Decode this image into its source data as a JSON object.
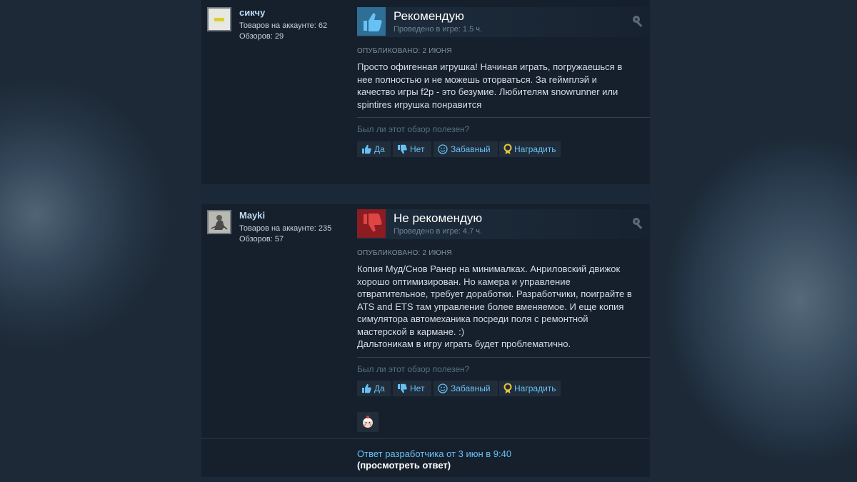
{
  "reviews": [
    {
      "author": "сикчу",
      "products_count": "Товаров на аккаунте: 62",
      "reviews_count": "Обзоров: 29",
      "verdict": "Рекомендую",
      "hours": "Проведено в игре: 1.5 ч.",
      "posted": "Опубликовано: 2 июня",
      "text_lines": [
        "Просто офигенная игрушка! Начиная играть, погружаешься в",
        "нее полностью и не можешь оторваться. За геймплэй и",
        "качество игры f2p - это безумие. Любителям snowrunner или",
        "spintires игрушка понравится"
      ],
      "helpful_question": "Был ли этот обзор полезен?",
      "buttons": {
        "yes": "Да",
        "no": "Нет",
        "funny": "Забавный",
        "award": "Наградить"
      }
    },
    {
      "author": "Mayki",
      "products_count": "Товаров на аккаунте: 235",
      "reviews_count": "Обзоров: 57",
      "verdict": "Не рекомендую",
      "hours": "Проведено в игре: 4.7 ч.",
      "posted": "Опубликовано: 2 июня",
      "text_lines": [
        "Копия Муд/Снов Ранер на минималках. Анриловский движок",
        "хорошо оптимизирован. Но камера и управление",
        "отвратительное, требует доработки. Разработчики, поиграйте в",
        "ATS and ETS там управление более вменяемое. И еще копия",
        "симулятора автомеханика посреди поля с ремонтной",
        "мастерской в кармане. :)",
        "Дальтоникам в игру играть будет проблематично."
      ],
      "helpful_question": "Был ли этот обзор полезен?",
      "buttons": {
        "yes": "Да",
        "no": "Нет",
        "funny": "Забавный",
        "award": "Наградить"
      },
      "developer_reply": {
        "link": "Ответ разработчика от 3 июн в 9:40",
        "view": "(просмотреть ответ)"
      }
    }
  ],
  "colors": {
    "recommend": "#2f6f96",
    "not_recommend": "#8a1c22",
    "link": "#66c0f4"
  },
  "icons": [
    "thumbs-up-icon",
    "thumbs-down-icon",
    "smiley-icon",
    "award-icon",
    "award-corner-icon",
    "emoji-award-icon"
  ]
}
